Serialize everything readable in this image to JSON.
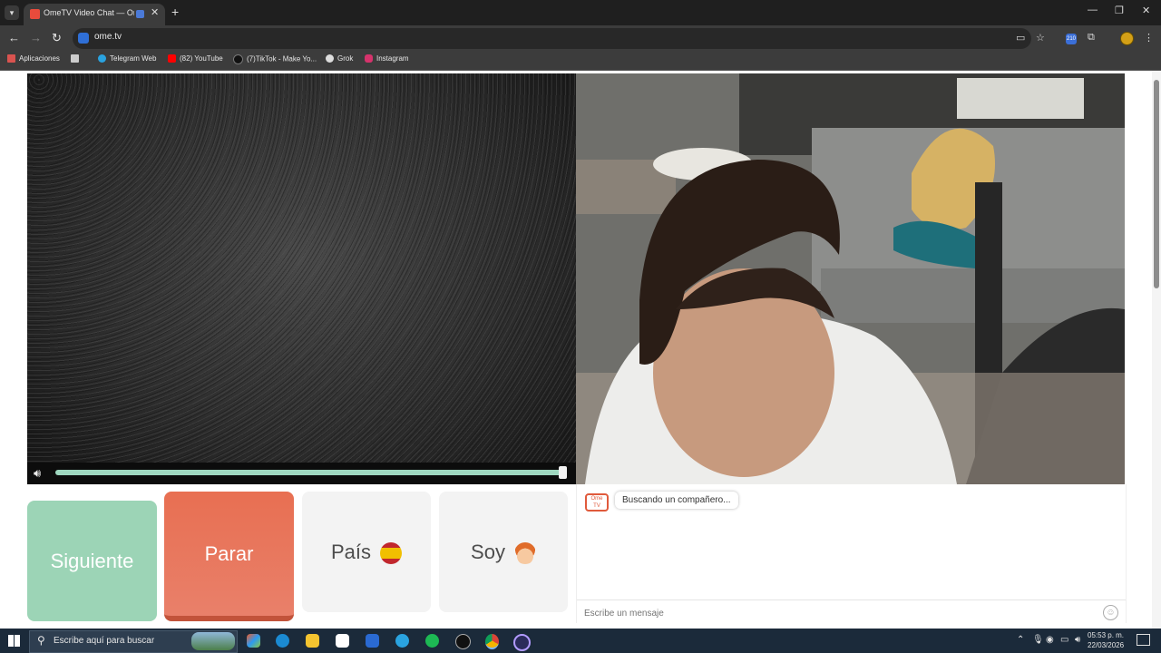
{
  "browser": {
    "tab_title": "OmeTV Video Chat — Ome",
    "url": "ome.tv",
    "extension_badge": "210",
    "bookmarks": [
      {
        "label": "Aplicaciones",
        "icon": "apps-grid-icon",
        "color": "#d9534f"
      },
      {
        "label": "",
        "icon": "grid-icon",
        "color": "#cccccc"
      },
      {
        "label": "Telegram Web",
        "icon": "telegram-icon",
        "color": "#2aa3e0"
      },
      {
        "label": "(82) YouTube",
        "icon": "youtube-icon",
        "color": "#ff0000"
      },
      {
        "label": "(7)TikTok - Make Yo...",
        "icon": "tiktok-icon",
        "color": "#111111"
      },
      {
        "label": "Grok",
        "icon": "grok-icon",
        "color": "#dddddd"
      },
      {
        "label": "Instagram",
        "icon": "instagram-icon",
        "color": "#d6336c"
      }
    ]
  },
  "controls": {
    "next_label": "Siguiente",
    "stop_label": "Parar",
    "country_label": "País",
    "gender_label": "Soy"
  },
  "volume": {
    "level": 0.99
  },
  "chat": {
    "logo_text": "Ome TV",
    "status_message": "Buscando un compañero...",
    "input_placeholder": "Escribe un mensaje"
  },
  "taskbar": {
    "search_placeholder": "Escribe aquí para buscar",
    "time": "05:53 p. m.",
    "date": "22/03/2026"
  },
  "colors": {
    "next": "#9cd4b6",
    "stop": "#e86f52",
    "accent_logo": "#e05a3c"
  }
}
